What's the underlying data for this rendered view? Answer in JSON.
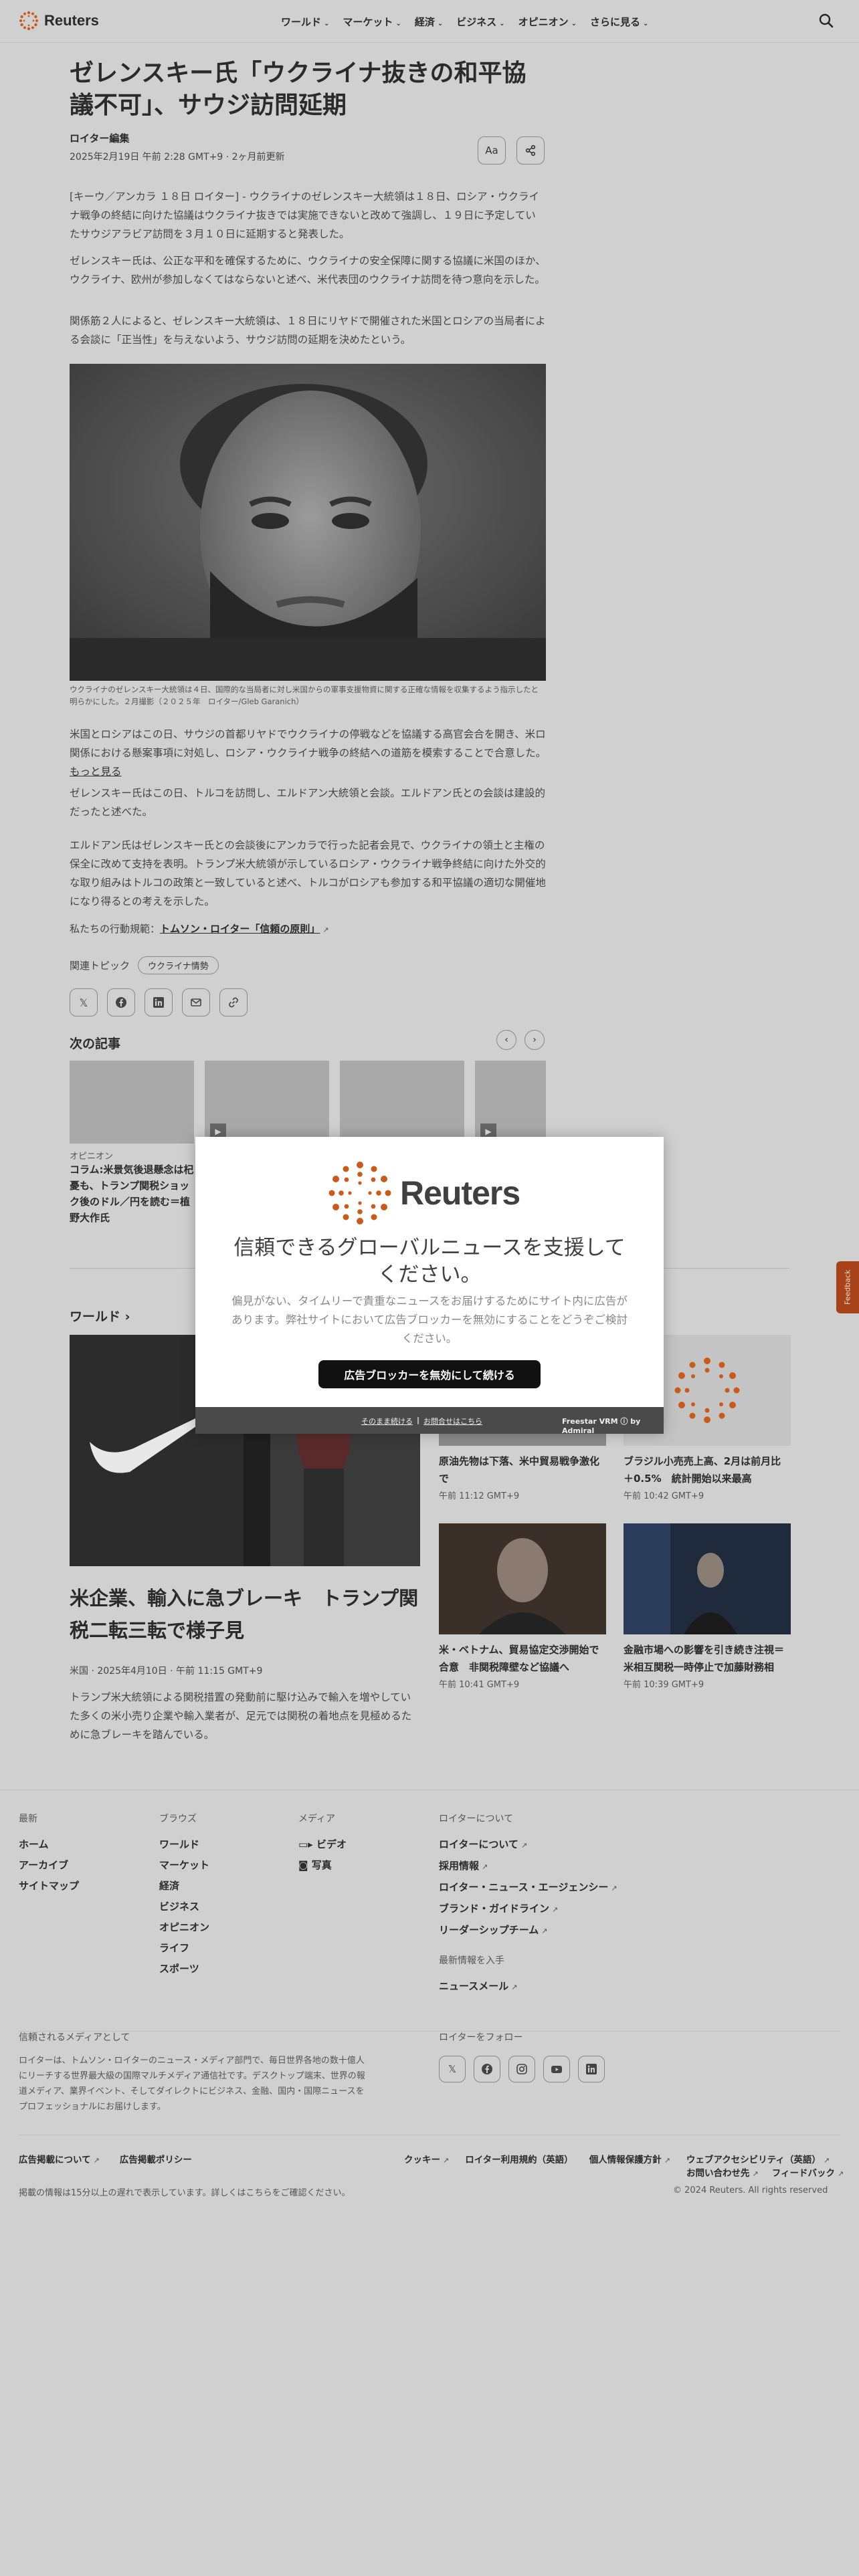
{
  "header": {
    "logo_text": "Reuters",
    "nav": [
      {
        "label": "ワールド"
      },
      {
        "label": "マーケット"
      },
      {
        "label": "経済"
      },
      {
        "label": "ビジネス"
      },
      {
        "label": "オピニオン"
      },
      {
        "label": "さらに見る"
      }
    ],
    "search_icon": "search-icon"
  },
  "article": {
    "title": "ゼレンスキー氏「ウクライナ抜きの和平協議不可」、サウジ訪問延期",
    "byline": "ロイター編集",
    "date": "2025年2月19日 午前 2:28 GMT+9 · 2ヶ月前更新",
    "font_button": "Aa",
    "paragraphs": [
      "[キーウ／アンカラ １８日 ロイター] - ウクライナのゼレンスキー大統領は１８日、ロシア・ウクライナ戦争の終結に向けた協議はウクライナ抜きでは実施できないと改めて強調し、１９日に予定していたサウジアラビア訪問を３月１０日に延期すると発表した。",
      "ゼレンスキー氏は、公正な平和を確保するために、ウクライナの安全保障に関する協議に米国のほか、ウクライナ、欧州が参加しなくてはならないと述べ、米代表団のウクライナ訪問を待つ意向を示した。",
      "関係筋２人によると、ゼレンスキー大統領は、１８日にリヤドで開催された米国とロシアの当局者による会談に「正当性」を与えないよう、サウジ訪問の延期を決めたという。",
      "米国とロシアはこの日、サウジの首都リヤドでウクライナの停戦などを協議する高官会合を開き、米ロ関係における懸案事項に対処し、ロシア・ウクライナ戦争の終結への道筋を模索することで合意した。",
      "ゼレンスキー氏はこの日、トルコを訪問し、エルドアン大統領と会談。エルドアン氏との会談は建設的だったと述べた。",
      "エルドアン氏はゼレンスキー氏との会談後にアンカラで行った記者会見で、ウクライナの領土と主権の保全に改めて支持を表明。トランプ米大統領が示しているロシア・ウクライナ戦争終結に向けた外交的な取り組みはトルコの政策と一致していると述べ、トルコがロシアも参加する和平協議の適切な開催地になり得るとの考えを示した。"
    ],
    "more_link": "もっと見る",
    "caption": "ウクライナのゼレンスキー大統領は４日、国際的な当局者に対し米国からの軍事支援物資に関する正確な情報を収集するよう指示したと明らかにした。２月撮影（２０２５年　ロイター/Gleb Garanich）",
    "principles_label": "私たちの行動規範：",
    "principles_link": "トムソン・ロイター「信頼の原則」",
    "topics_label": "関連トピック",
    "topics": [
      "ウクライナ情勢"
    ],
    "share_icons": [
      "x-icon",
      "facebook-icon",
      "linkedin-icon",
      "mail-icon",
      "link-icon"
    ]
  },
  "next_articles": {
    "heading": "次の記事",
    "cards": [
      {
        "kicker": "オピニオン",
        "title": "コラム:米景気後退懸念は杞憂も、トランプ関税ショック後のドル／円を読む＝植野大作氏"
      },
      {
        "kicker": "",
        "title": ""
      },
      {
        "kicker": "",
        "title": ""
      },
      {
        "kicker": "",
        "title": ""
      }
    ]
  },
  "world": {
    "heading": "ワールド",
    "hero": {
      "title": "米企業、輸入に急ブレーキ　トランプ関税二転三転で様子見",
      "meta": "米国 · 2025年4月10日 · 午前 11:15 GMT+9",
      "desc": "トランプ米大統領による関税措置の発動前に駆け込みで輸入を増やしていた多くの米小売り企業や輸入業者が、足元では関税の着地点を見極めるために急ブレーキを踏んでいる。"
    },
    "cards": [
      {
        "title": "原油先物は下落、米中貿易戦争激化で",
        "meta": "午前 11:12 GMT+9"
      },
      {
        "title": "ブラジル小売売上高、2月は前月比＋0.5%　統計開始以来最高",
        "meta": "午前 10:42 GMT+9"
      },
      {
        "title": "米・ベトナム、貿易協定交渉開始で合意　非関税障壁など協議へ",
        "meta": "午前 10:41 GMT+9"
      },
      {
        "title": "金融市場への影響を引き続き注視＝米相互関税一時停止で加藤財務相",
        "meta": "午前 10:39 GMT+9"
      }
    ]
  },
  "footer": {
    "columns": [
      {
        "heading": "最新",
        "items": [
          "ホーム",
          "アーカイブ",
          "サイトマップ"
        ]
      },
      {
        "heading": "ブラウズ",
        "items": [
          "ワールド",
          "マーケット",
          "経済",
          "ビジネス",
          "オピニオン",
          "ライフ",
          "スポーツ"
        ]
      },
      {
        "heading": "メディア",
        "items": [
          "ビデオ",
          "写真"
        ]
      },
      {
        "heading": "ロイターについて",
        "items": [
          "ロイターについて",
          "採用情報",
          "ロイター・ニュース・エージェンシー",
          "ブランド・ガイドライン",
          "リーダーシップチーム"
        ]
      }
    ],
    "newsletter_heading": "最新情報を入手",
    "newsletter_item": "ニュースメール",
    "trusted_heading": "信頼されるメディアとして",
    "trusted_text": "ロイターは、トムソン・ロイターのニュース・メディア部門で、毎日世界各地の数十億人にリーチする世界最大級の国際マルチメディア通信社です。デスクトップ端末、世界の報道メディア、業界イベント、そしてダイレクトにビジネス、金融、国内・国際ニュースをプロフェッショナルにお届けします。",
    "follow_heading": "ロイターをフォロー",
    "follow_icons": [
      "x-icon",
      "facebook-icon",
      "instagram-icon",
      "youtube-icon",
      "linkedin-icon"
    ],
    "legal_left": [
      "広告掲載について",
      "広告掲載ポリシー"
    ],
    "legal_right": [
      "クッキー",
      "ロイター利用規約（英語）",
      "個人情報保護方針",
      "ウェブアクセシビリティ（英語）"
    ],
    "legal_right2": [
      "お問い合わせ先",
      "フィードバック"
    ],
    "delay_notice": "掲載の情報は15分以上の遅れで表示しています。詳しくはこちらをご確認ください。",
    "copyright": "© 2024 Reuters. All rights reserved"
  },
  "feedback_tab": "Feedback",
  "modal": {
    "logo_text": "Reuters",
    "heading": "信頼できるグローバルニュースを支援してください。",
    "body": "偏見がない、タイムリーで貴重なニュースをお届けするためにサイト内に広告があります。弊社サイトにおいて広告ブロッカーを無効にすることをどうぞご検討ください。",
    "button": "広告ブロッカーを無効にして続ける",
    "link_continue": "そのまま続ける",
    "link_separator": "|",
    "link_help": "お問合せはこちら",
    "brand": "Freestar VRM ⓘ by Admiral"
  },
  "colors": {
    "brand_orange": "#fa6400",
    "modal_button": "#111111",
    "feedback": "#a8421a"
  }
}
